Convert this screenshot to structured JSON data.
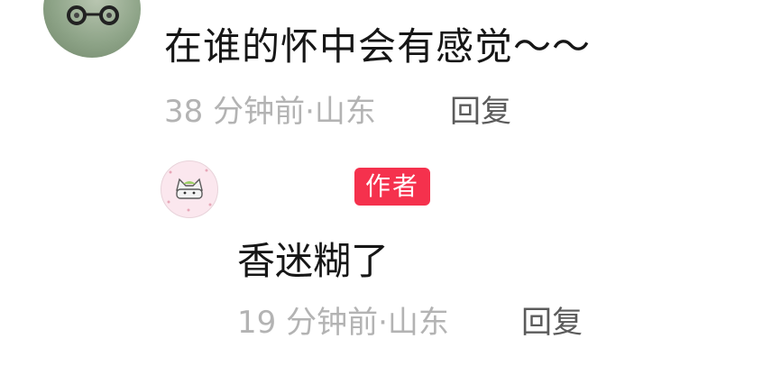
{
  "comment": {
    "text": "在谁的怀中会有感觉～～",
    "meta": "38 分钟前·山东",
    "reply_label": "回复"
  },
  "author_reply": {
    "badge": "作者",
    "text": "香迷糊了",
    "meta": "19 分钟前·山东",
    "reply_label": "回复"
  },
  "colors": {
    "badge_bg": "#f5314d",
    "primary_text": "#161616",
    "meta_text": "#b3b3b3",
    "reply_text": "#5b5b5b"
  }
}
